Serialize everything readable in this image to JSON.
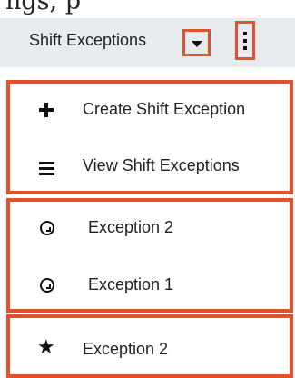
{
  "page_top_text": "ngs, p",
  "header": {
    "module_title": "Shift Exceptions",
    "caret_icon": "caret-down-icon",
    "kebab_icon": "kebab-menu-icon"
  },
  "menu": {
    "actions": [
      {
        "label": "Create Shift Exception",
        "icon": "plus-icon"
      },
      {
        "label": "View Shift Exceptions",
        "icon": "list-icon"
      }
    ],
    "recently_viewed": [
      {
        "label": "Exception 2",
        "icon": "clock-icon"
      },
      {
        "label": "Exception 1",
        "icon": "clock-icon"
      }
    ],
    "favorites": [
      {
        "label": "Exception 2",
        "icon": "star-icon"
      }
    ]
  },
  "colors": {
    "highlight_border": "#e2512e",
    "header_bg": "#e7eaee",
    "text": "#222222"
  }
}
